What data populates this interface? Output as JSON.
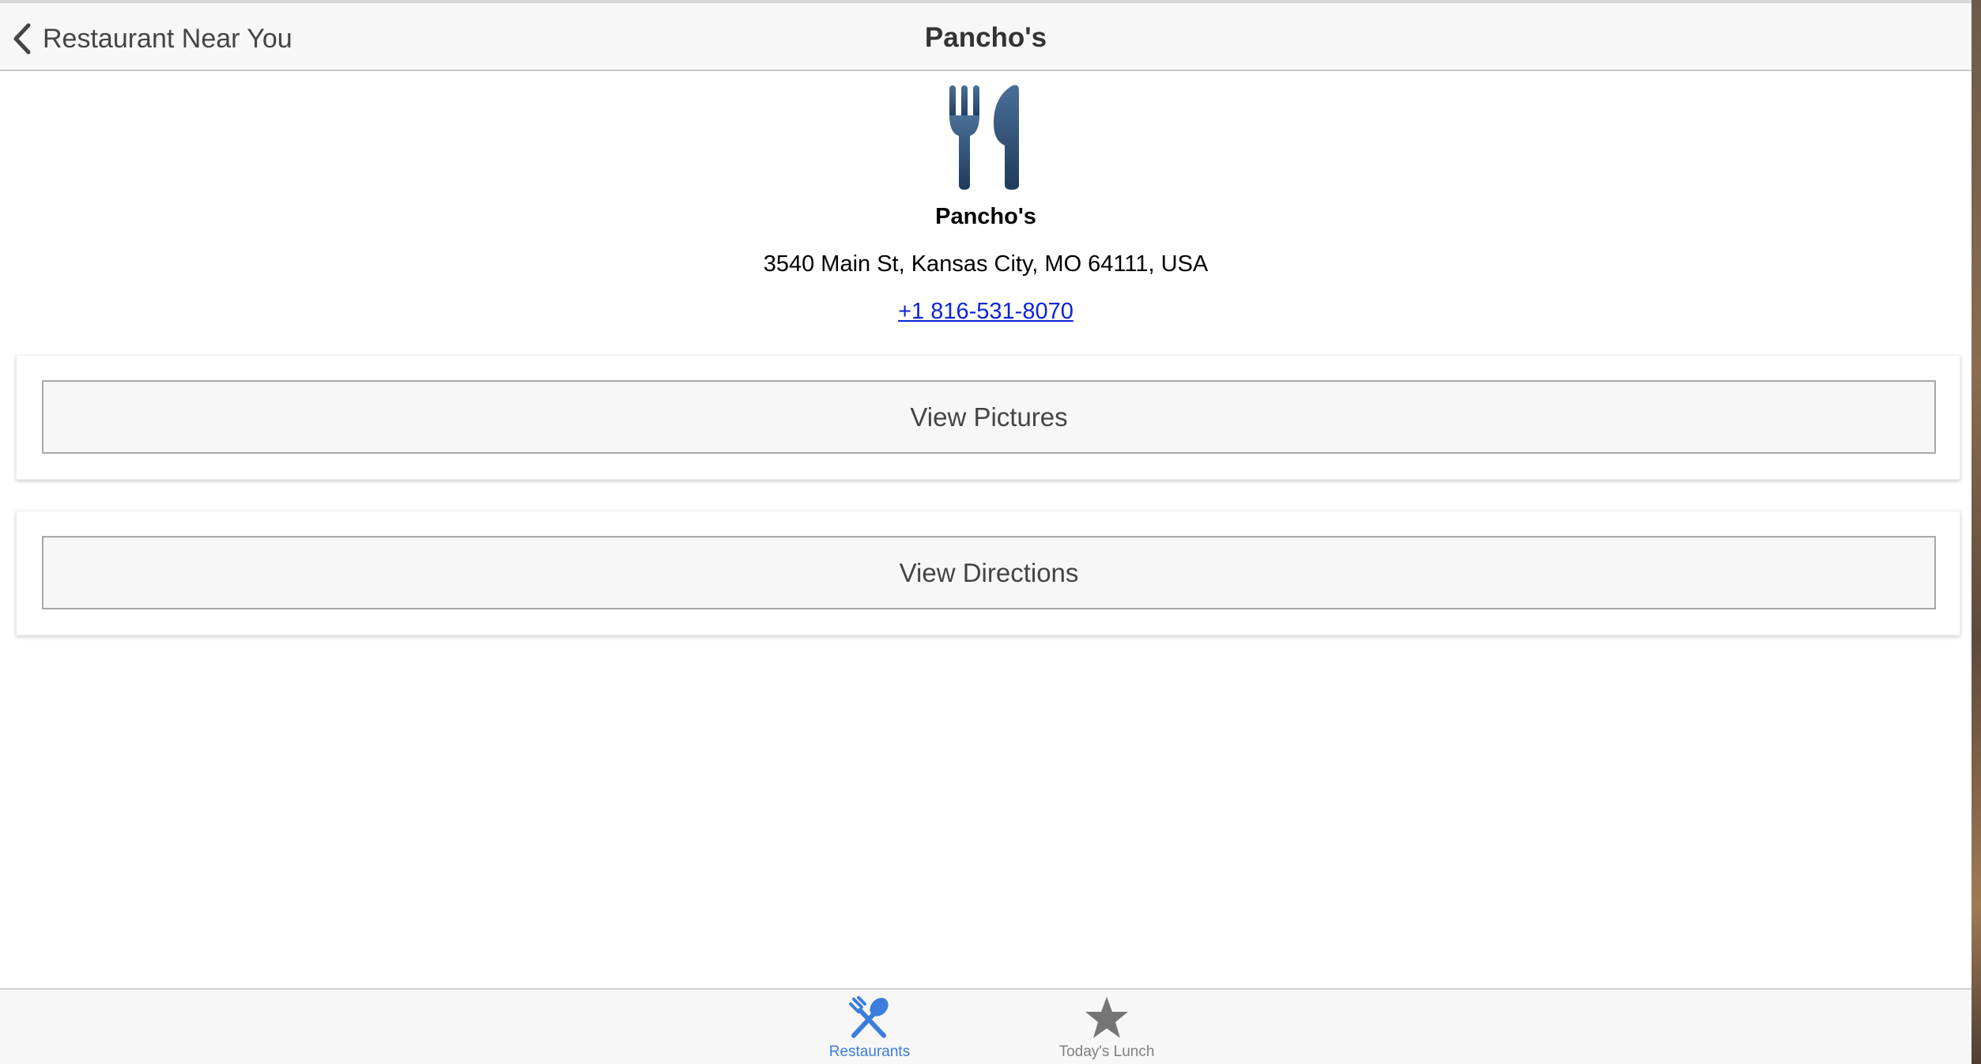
{
  "header": {
    "back_label": "Restaurant Near You",
    "title": "Pancho's",
    "back_icon": "chevron-left-icon"
  },
  "detail": {
    "icon": "fork-and-knife-icon",
    "name": "Pancho's",
    "address": "3540 Main St, Kansas City, MO 64111, USA",
    "phone": "+1 816-531-8070"
  },
  "actions": {
    "pictures_label": "View Pictures",
    "directions_label": "View Directions"
  },
  "tabs": [
    {
      "label": "Restaurants",
      "icon": "utensils-cross-icon",
      "active": true
    },
    {
      "label": "Today's Lunch",
      "icon": "star-icon",
      "active": false
    }
  ],
  "colors": {
    "accent": "#3b7ddd",
    "link": "#0b24d8",
    "icon_dark_blue": "#2e4a6b",
    "inactive_tab": "#808080"
  }
}
